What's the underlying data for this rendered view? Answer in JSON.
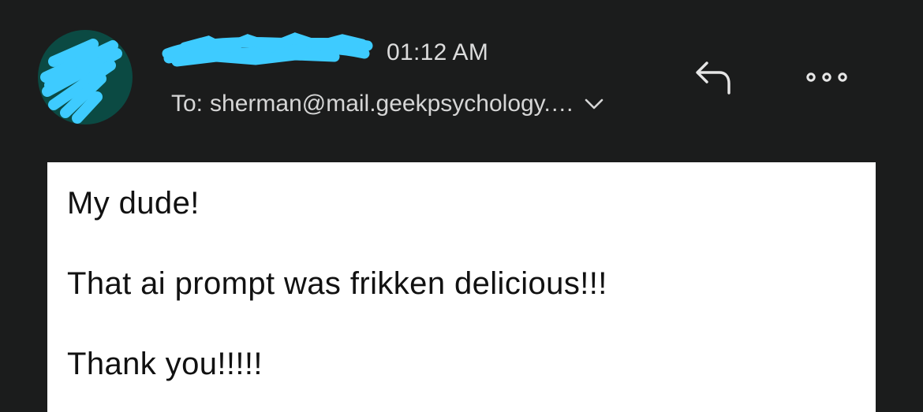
{
  "header": {
    "sender_name": "",
    "timestamp": "01:12 AM",
    "recipient_label": "To:",
    "recipient_value": "sherman@mail.geekpsychology.…",
    "redaction_color": "#3ecbff",
    "avatar_bg_color": "#0b4a43"
  },
  "actions": {
    "reply_icon": "reply-icon",
    "more_icon": "more-options-icon",
    "expand_icon": "chevron-down-icon"
  },
  "message": {
    "lines": [
      "My dude!",
      "That ai prompt was frikken delicious!!!",
      "Thank you!!!!!"
    ]
  },
  "colors": {
    "background": "#1b1c1c",
    "card": "#ffffff",
    "text_light": "#dcdcdc",
    "text_dark": "#111111"
  }
}
